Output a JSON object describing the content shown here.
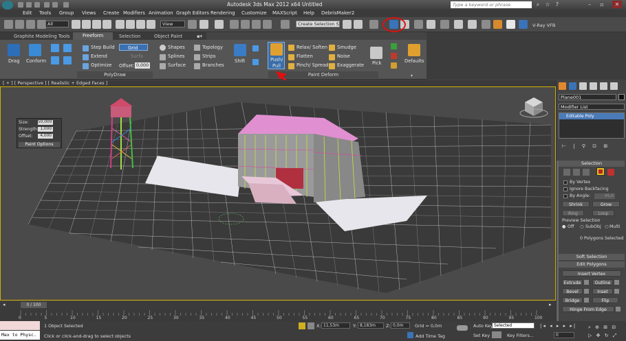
{
  "window": {
    "title": "Autodesk 3ds Max  2012 x64       Untitled",
    "search_placeholder": "Type a keyword or phrase"
  },
  "menu": [
    "Edit",
    "Tools",
    "Group",
    "Views",
    "Create",
    "Modifiers",
    "Animation",
    "Graph Editors",
    "Rendering",
    "Customize",
    "MAXScript",
    "Help",
    "DebrisMaker2"
  ],
  "toolbar": {
    "selection_filter": "All",
    "reference_coord": "View",
    "named_selection": "Create Selection S",
    "vray_label": "V-Ray VFB"
  },
  "ribbon": {
    "tabs": [
      "Graphite Modeling Tools",
      "Freeform",
      "Selection",
      "Object Paint"
    ],
    "active_tab": "Freeform",
    "buttons": {
      "drag": "Drag",
      "conform": "Conform",
      "step_build": "Step Build",
      "extend": "Extend",
      "optimize": "Optimize",
      "grid": "Grid",
      "draw_on_faded": "Surfa",
      "offset_label": "Offset:",
      "offset_value": "0,000",
      "shapes": "Shapes",
      "splines": "Splines",
      "surface": "Surface",
      "topology": "Topology",
      "strips": "Strips",
      "branches": "Branches",
      "shift": "Shift",
      "push_pull_1": "Push/",
      "push_pull_2": "Pull",
      "relax_soften": "Relax/ Soften",
      "flatten": "Flatten",
      "pinch_spread": "Pinch/ Spread",
      "smudge": "Smudge",
      "noise": "Noise",
      "exaggerate": "Exaggerate",
      "pick": "Pick",
      "defaults": "Defaults"
    },
    "panels": [
      "PolyDraw",
      "Paint Deform"
    ]
  },
  "viewport": {
    "label": "[ + ] [ Perspective ] [ Realistic + Edged Faces ]",
    "paint_options": {
      "size_label": "Size:",
      "size_value": "50,000",
      "strength_label": "Strength:",
      "strength_value": "1,000",
      "offset_label": "Offset:",
      "offset_value": "4,000",
      "button": "Paint Options"
    }
  },
  "command_panel": {
    "object_name": "Plane001",
    "modifier_list": "Modifier List",
    "stack_item": "Editable Poly",
    "selection": {
      "title": "Selection",
      "by_vertex": "By Vertex",
      "ignore_backfacing": "Ignore Backfacing",
      "by_angle": "By Angle:",
      "by_angle_value": "45,0",
      "shrink": "Shrink",
      "grow": "Grow",
      "ring": "Ring",
      "loop": "Loop",
      "preview_selection": "Preview Selection",
      "off": "Off",
      "subobj": "SubObj",
      "multi": "Multi",
      "count": "0 Polygons Selected"
    },
    "soft_selection": "Soft Selection",
    "edit_polygons": {
      "title": "Edit Polygons",
      "insert_vertex": "Insert Vertex",
      "extrude": "Extrude",
      "outline": "Outline",
      "bevel": "Bevel",
      "inset": "Inset",
      "bridge": "Bridge",
      "flip": "Flip",
      "hinge_from_edge": "Hinge From Edge"
    }
  },
  "timeline": {
    "frame": "0 / 100",
    "ticks": [
      "0",
      "5",
      "10",
      "15",
      "20",
      "25",
      "30",
      "35",
      "40",
      "45",
      "50",
      "55",
      "60",
      "65",
      "70",
      "75",
      "80",
      "85",
      "90",
      "95",
      "100"
    ]
  },
  "status": {
    "maxscript": "Max to Physc.",
    "selected": "1 Object Selected",
    "prompt": "Click or click-and-drag to select objects",
    "x_label": "X:",
    "x_value": "11,53m",
    "y_label": "Y:",
    "y_value": "8,183m",
    "z_label": "Z:",
    "z_value": "0,0m",
    "grid": "Grid = 0,0m",
    "add_time_tag": "Add Time Tag",
    "auto_key": "Auto Key",
    "auto_key_value": "Selected",
    "set_key": "Set Key",
    "key_filters": "Key Filters...",
    "frame_value": "0"
  }
}
